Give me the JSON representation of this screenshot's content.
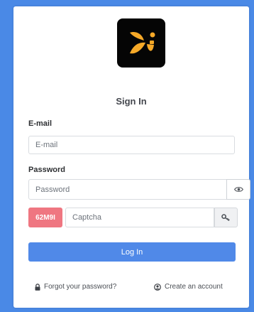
{
  "form": {
    "title": "Sign In",
    "email_label": "E-mail",
    "email_placeholder": "E-mail",
    "password_label": "Password",
    "password_placeholder": "Password",
    "captcha_code": "62M9I",
    "captcha_placeholder": "Captcha",
    "login_label": "Log In",
    "forgot_label": "Forgot your password?",
    "create_label": "Create an account"
  },
  "icons": {
    "logo": "app-logo",
    "eye": "eye-icon",
    "key": "key-icon",
    "lock": "lock-icon",
    "user": "user-circle-icon"
  },
  "colors": {
    "background": "#4a89e6",
    "logo_bg": "#050505",
    "logo_mark": "#f6a928",
    "captcha_bg": "#ef7681",
    "button": "#5089e8"
  }
}
